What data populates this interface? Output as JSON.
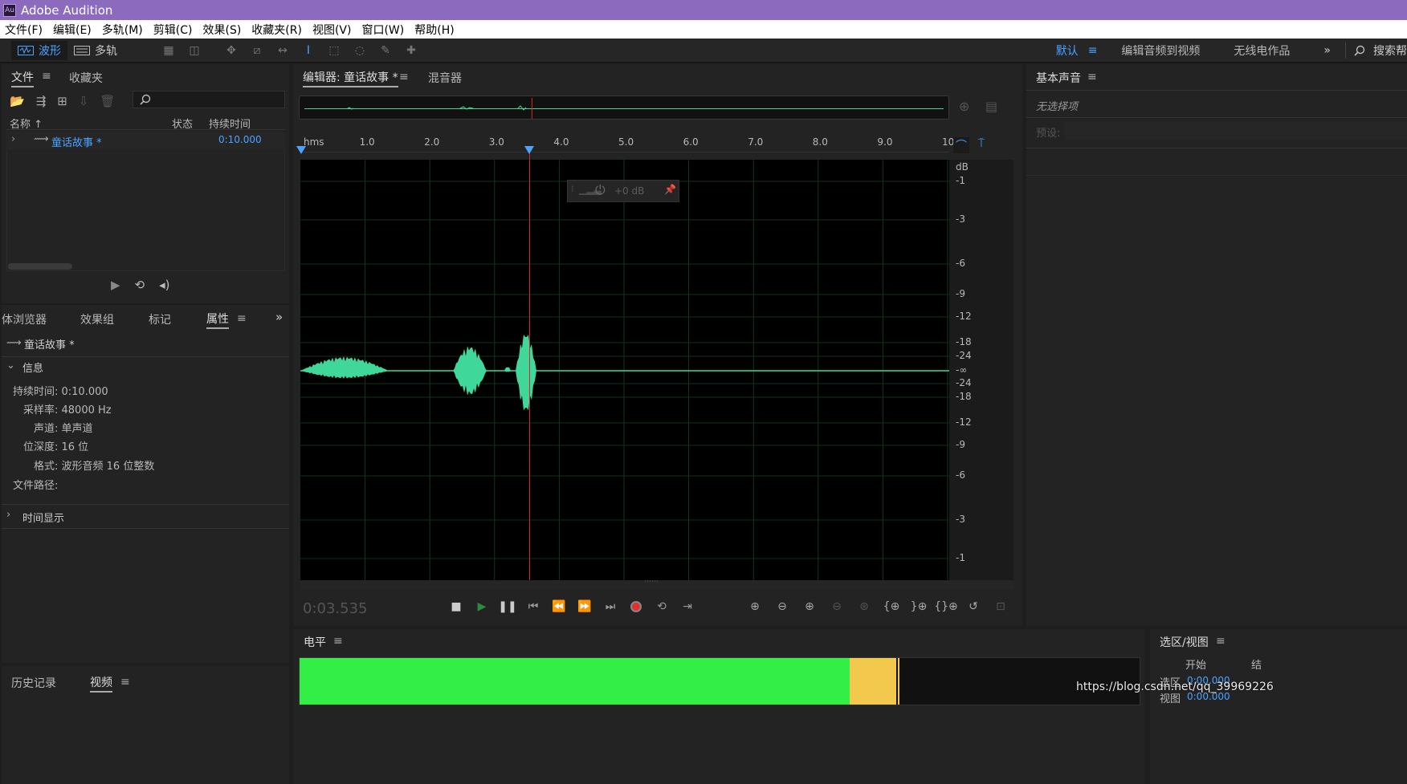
{
  "app": {
    "title": "Adobe Audition",
    "logo": "Au"
  },
  "menu": [
    "文件(F)",
    "编辑(E)",
    "多轨(M)",
    "剪辑(C)",
    "效果(S)",
    "收藏夹(R)",
    "视图(V)",
    "窗口(W)",
    "帮助(H)"
  ],
  "toolbar": {
    "waveform_label": "波形",
    "multitrack_label": "多轨",
    "workspaces": [
      "默认",
      "编辑音频到视频",
      "无线电作品"
    ],
    "more_glyph": "»",
    "search_label": "搜索帮"
  },
  "files_panel": {
    "tab_files": "文件",
    "tab_favorites": "收藏夹",
    "col_name": "名称 ↑",
    "col_status": "状态",
    "col_duration": "持续时间",
    "file_name": "童话故事 *",
    "file_duration": "0:10.000"
  },
  "lower_tabs": {
    "media_browser": "体浏览器",
    "effects_rack": "效果组",
    "markers": "标记",
    "properties": "属性"
  },
  "properties": {
    "file_name": "童话故事 *",
    "info_header": "信息",
    "duration": "持续时间: 0:10.000",
    "sample_rate": "采样率: 48000 Hz",
    "channels": "声道: 单声道",
    "bit_depth": "位深度: 16 位",
    "format": "格式: 波形音频 16 位整数",
    "path": "文件路径:",
    "time_display": "时间显示"
  },
  "bottom_left": {
    "history": "历史记录",
    "video": "视频"
  },
  "editor": {
    "tab_editor": "编辑器: 童话故事 *",
    "tab_mixer": "混音器",
    "ruler_unit": "hms",
    "ruler_labels": [
      "1.0",
      "2.0",
      "3.0",
      "4.0",
      "5.0",
      "6.0",
      "7.0",
      "8.0",
      "9.0",
      "10"
    ],
    "db_unit": "dB",
    "db_labels": [
      "-1",
      "-3",
      "-6",
      "-9",
      "-12",
      "-18",
      "-24",
      "-∞",
      "-24",
      "-18",
      "-12",
      "-9",
      "-6",
      "-3",
      "-1"
    ],
    "hud_gain": "+0 dB",
    "current_time": "0:03.535",
    "playhead_seconds": 3.535,
    "duration_seconds": 10
  },
  "essential_sound": {
    "title": "基本声音",
    "no_selection": "无选择项",
    "preset_label": "预设:"
  },
  "levels": {
    "title": "电平",
    "green_level": 0.655,
    "yellow_level": 0.055
  },
  "selection_view": {
    "title": "选区/视图",
    "start_label": "开始",
    "end_label": "结",
    "row_selection": "选区",
    "row_view": "视图",
    "value": "0:00.000"
  },
  "watermark": "https://blog.csdn.net/qq_39969226",
  "colors": {
    "waveform": "#3fd79a",
    "playhead": "#d62828",
    "accent": "#4aa3ff",
    "titlebar": "#8c6bbf"
  }
}
